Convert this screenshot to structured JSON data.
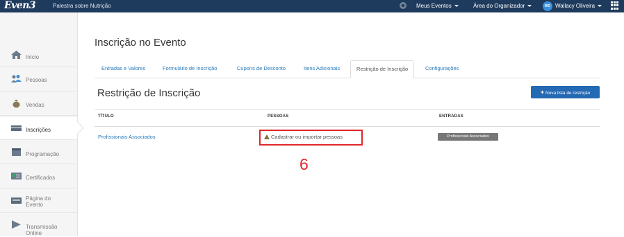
{
  "topbar": {
    "logo": "Even3",
    "event_title": "Palestra sobre Nutrição",
    "my_events": "Meus Eventos",
    "organizer_area": "Área do Organizador",
    "avatar_initials": "WO",
    "user_name": "Wallacy Oliveira"
  },
  "sidebar": {
    "items": [
      {
        "label": "Início",
        "icon": "home-icon"
      },
      {
        "label": "Pessoas",
        "icon": "people-icon"
      },
      {
        "label": "Vendas",
        "icon": "money-bag-icon"
      },
      {
        "label": "Inscrições",
        "icon": "list-icon"
      },
      {
        "label": "Programação",
        "icon": "calendar-icon"
      },
      {
        "label": "Certificados",
        "icon": "certificate-icon"
      },
      {
        "label_line1": "Página do",
        "label_line2": "Evento",
        "icon": "page-icon"
      },
      {
        "label_line1": "Transmissão",
        "label_line2": "Online",
        "icon": "play-icon"
      }
    ]
  },
  "main": {
    "page_heading": "Inscrição no Evento",
    "tabs": [
      "Entradas e Valores",
      "Formulário de Inscrição",
      "Cupons de Desconto",
      "Itens Adicionais",
      "Restrição de Inscrição",
      "Configurações"
    ],
    "active_tab": "Restrição de Inscrição",
    "section_title": "Restrição de Inscrição",
    "add_button": "Nova lista de restrição",
    "table": {
      "headers": [
        "TÍTULO",
        "PESSOAS",
        "ENTRADAS"
      ],
      "rows": [
        {
          "title": "Profissionais Associados",
          "people": "Cadastrar ou importar pessoas",
          "entry": "Profissionais Associados"
        }
      ]
    },
    "annotation": "6"
  },
  "colors": {
    "topbar": "#1e3a5c",
    "link": "#2a7ab9",
    "primary_button": "#2469b3",
    "highlight": "#e0262b",
    "badge": "#777777"
  }
}
